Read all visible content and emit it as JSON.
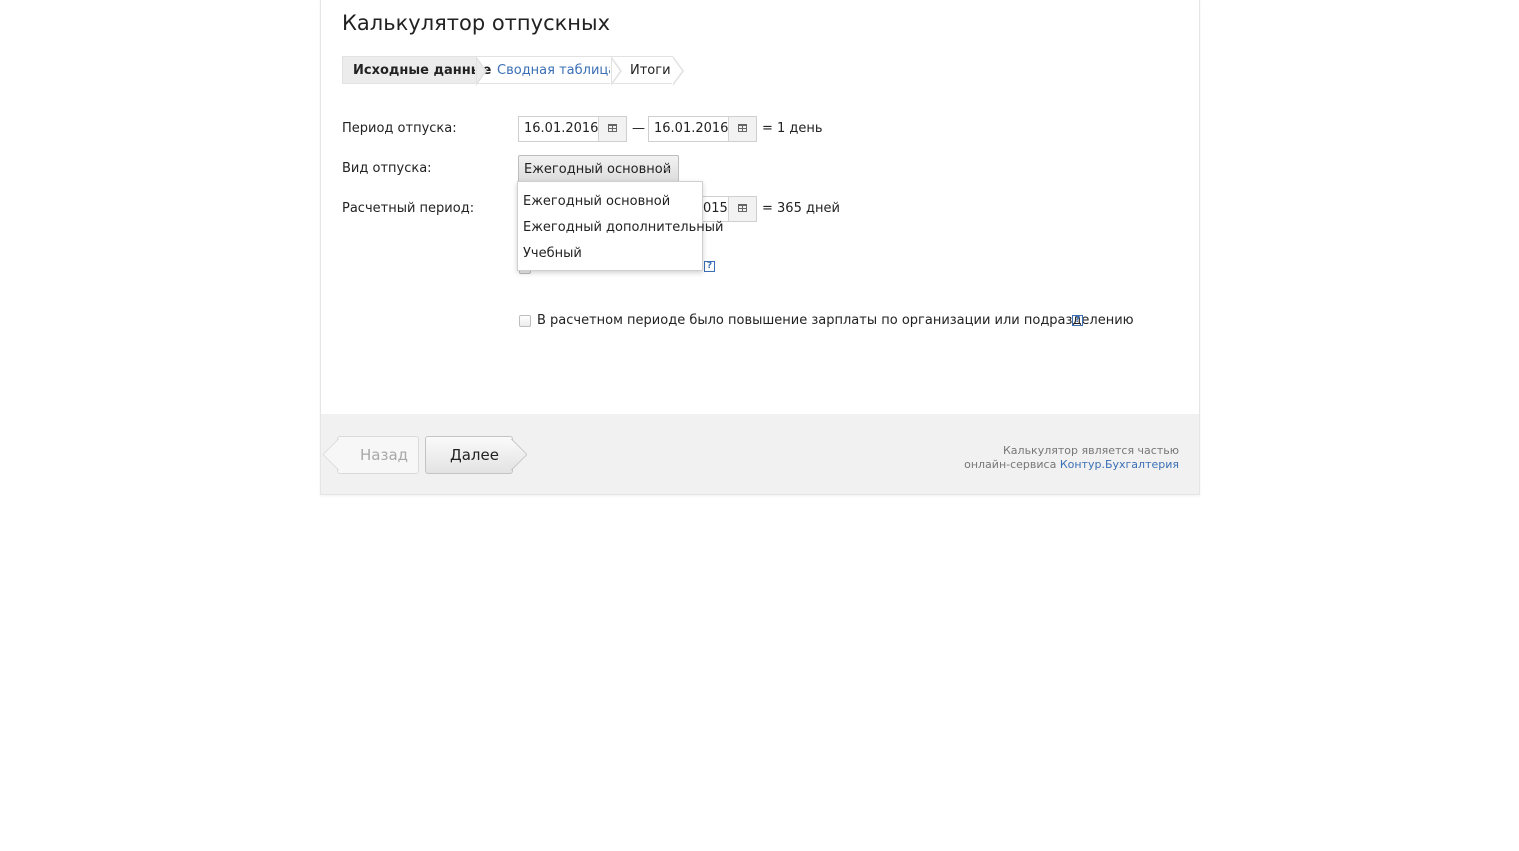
{
  "title": "Калькулятор отпускных",
  "steps": [
    {
      "label": "Исходные данные"
    },
    {
      "label": "Сводная таблица"
    },
    {
      "label": "Итоги"
    }
  ],
  "form": {
    "vacation_period": {
      "label": "Период отпуска:",
      "from": "16.01.2016",
      "dash": "—",
      "to": "16.01.2016",
      "result": "= 1 день"
    },
    "vacation_type": {
      "label": "Вид отпуска:",
      "selected": "Ежегодный основной",
      "options": [
        "Ежегодный основной",
        "Ежегодный дополнительный",
        "Учебный"
      ]
    },
    "calc_period": {
      "label": "Расчетный период:",
      "to_partial": "015",
      "result": "= 365 дней"
    },
    "salary_increase": {
      "label": "В расчетном периоде было повышение зарплаты по организации или подразделению",
      "help": "?"
    },
    "hidden_help": "?"
  },
  "footer": {
    "back_label": "Назад",
    "next_label": "Далее",
    "note_line1": "Калькулятор является частью",
    "note_line2": "онлайн-сервиса ",
    "note_link": "Контур.Бухгалтерия"
  },
  "colors": {
    "accent": "#3a6fb5",
    "footer_bg": "#f1f1f1"
  }
}
